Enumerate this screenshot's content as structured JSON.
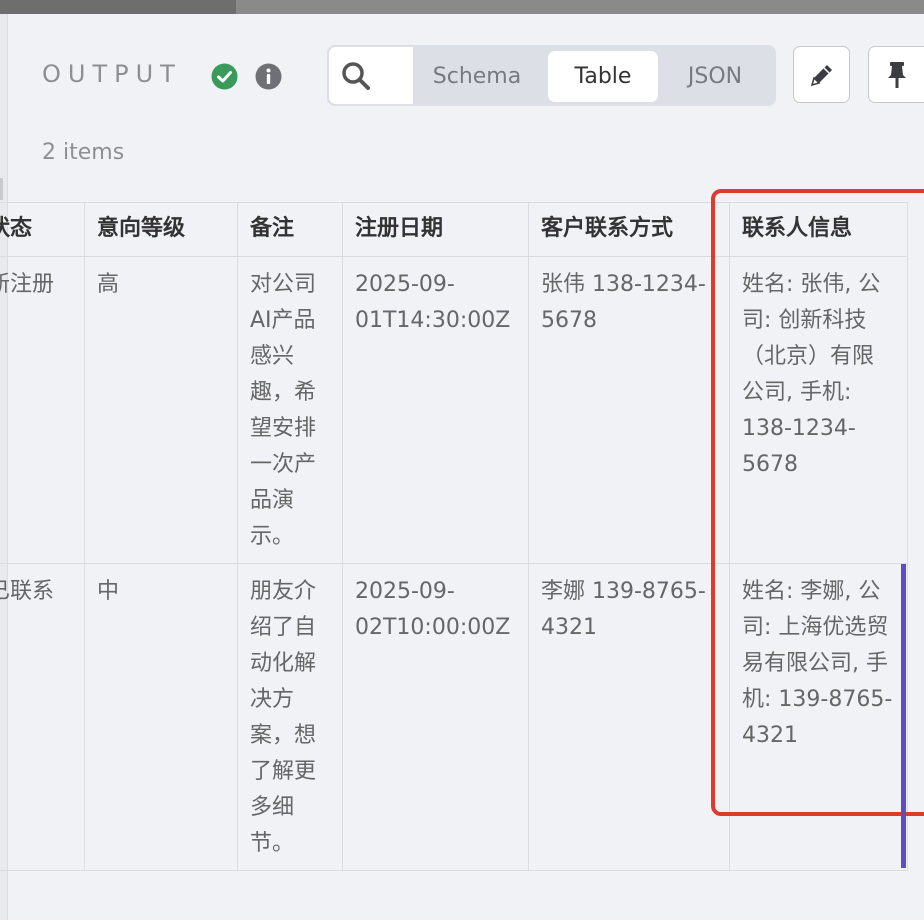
{
  "panel": {
    "title": "OUTPUT",
    "items_count": "2 items"
  },
  "view_tabs": {
    "schema": "Schema",
    "table": "Table",
    "json": "JSON",
    "selected": "Table"
  },
  "icons": {
    "status": "check-circle-icon",
    "info": "info-icon",
    "search": "search-icon",
    "edit": "pencil-icon",
    "pin": "pin-icon"
  },
  "colors": {
    "success": "#3a9a5b",
    "highlight": "#e03a2c",
    "accent": "#5c4ec2"
  },
  "table": {
    "headers": [
      "状态",
      "意向等级",
      "备注",
      "注册日期",
      "客户联系方式",
      "联系人信息"
    ],
    "rows": [
      [
        "新注册",
        "高",
        "对公司AI产品感兴趣，希望安排一次产品演示。",
        "2025-09-01T14:30:00Z",
        "张伟 138-1234-5678",
        "姓名: 张伟, 公司: 创新科技（北京）有限公司, 手机: 138-1234-5678"
      ],
      [
        "已联系",
        "中",
        "朋友介绍了自动化解决方案，想了解更多细节。",
        "2025-09-02T10:00:00Z",
        "李娜 139-8765-4321",
        "姓名: 李娜, 公司: 上海优选贸易有限公司, 手机: 139-8765-4321"
      ]
    ]
  }
}
